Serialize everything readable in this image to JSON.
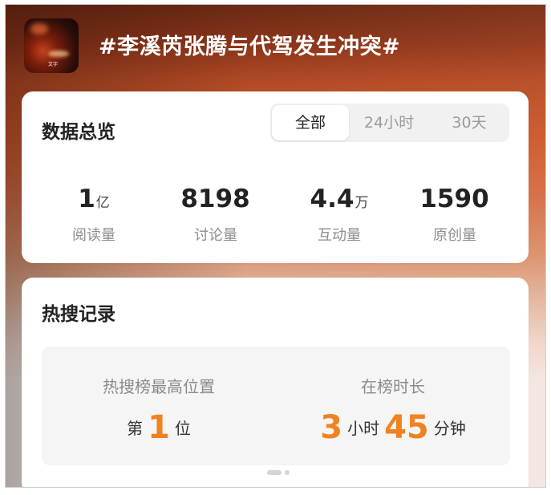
{
  "header": {
    "topic_title": "#李溪芮张腾与代驾发生冲突#",
    "thumbnail_caption": "文字"
  },
  "overview": {
    "title": "数据总览",
    "tabs": [
      {
        "label": "全部",
        "active": true
      },
      {
        "label": "24小时",
        "active": false
      },
      {
        "label": "30天",
        "active": false
      }
    ],
    "stats": [
      {
        "value": "1",
        "unit": "亿",
        "label": "阅读量"
      },
      {
        "value": "8198",
        "unit": "",
        "label": "讨论量"
      },
      {
        "value": "4.4",
        "unit": "万",
        "label": "互动量"
      },
      {
        "value": "1590",
        "unit": "",
        "label": "原创量"
      }
    ]
  },
  "hot_record": {
    "title": "热搜记录",
    "peak": {
      "label": "热搜榜最高位置",
      "prefix": "第",
      "rank": "1",
      "suffix": "位"
    },
    "duration": {
      "label": "在榜时长",
      "hours": "3",
      "hours_unit": "小时",
      "minutes": "45",
      "minutes_unit": "分钟"
    }
  },
  "colors": {
    "accent_orange": "#f08321",
    "header_red": "#8a341a"
  }
}
